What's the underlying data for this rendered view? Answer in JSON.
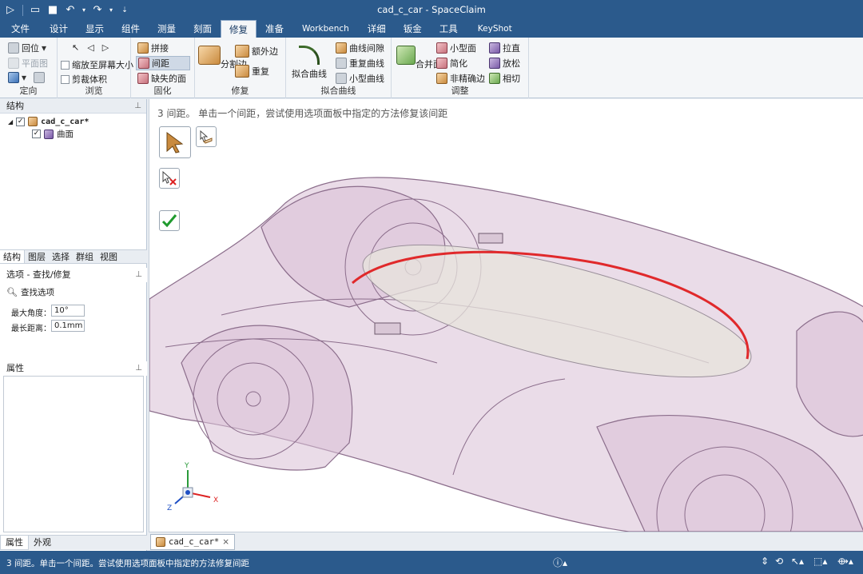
{
  "window": {
    "title": "cad_c_car - SpaceClaim"
  },
  "tabs": [
    {
      "label": "文件"
    },
    {
      "label": "设计"
    },
    {
      "label": "显示"
    },
    {
      "label": "组件"
    },
    {
      "label": "测量"
    },
    {
      "label": "刻面"
    },
    {
      "label": "修复",
      "active": true
    },
    {
      "label": "准备"
    },
    {
      "label": "Workbench"
    },
    {
      "label": "详细"
    },
    {
      "label": "钣金"
    },
    {
      "label": "工具"
    },
    {
      "label": "KeyShot"
    }
  ],
  "ribbon": {
    "orient": {
      "label": "定向",
      "home": "回位",
      "plane_view": "平面图"
    },
    "browse": {
      "label": "浏览",
      "zoom_fit": "缩放至屏幕大小",
      "clip": "剪裁体积"
    },
    "solidify": {
      "label": "固化",
      "stitch": "拼接",
      "gaps": "间距",
      "missing_faces": "缺失的面"
    },
    "fix": {
      "label": "修复",
      "split_edge": "分割边",
      "extra_edges": "额外边",
      "duplicates": "重复"
    },
    "fit_curves": {
      "label": "拟合曲线",
      "fit_curve": "拟合曲线",
      "curve_gaps": "曲线间隙",
      "duplicate_curves": "重复曲线",
      "small_curves": "小型曲线"
    },
    "adjust": {
      "label": "调整",
      "merge_faces": "合并面",
      "small_faces": "小型面",
      "simplify": "简化",
      "inexact_edges": "非精确边",
      "straighten": "拉直",
      "relax": "放松",
      "tangency": "相切"
    }
  },
  "structure_panel": {
    "title": "结构",
    "root": "cad_c_car*",
    "child": "曲面"
  },
  "left_tabs": [
    {
      "label": "结构",
      "active": true
    },
    {
      "label": "图层"
    },
    {
      "label": "选择"
    },
    {
      "label": "群组"
    },
    {
      "label": "视图"
    }
  ],
  "options_panel": {
    "title": "选项 - 查找/修复",
    "find_options": "查找选项",
    "max_angle_label": "最大角度：",
    "max_angle_value": "10°",
    "max_distance_label": "最长距离：",
    "max_distance_value": "0.1mm"
  },
  "properties_panel": {
    "title": "属性"
  },
  "bottom_tabs": [
    {
      "label": "属性",
      "active": true
    },
    {
      "label": "外观"
    }
  ],
  "viewport": {
    "hint": "3 间距。 单击一个间距，尝试使用选项面板中指定的方法修复该间距",
    "triad": {
      "y": "Y",
      "z": "Z",
      "x": "X"
    }
  },
  "doc_tab": {
    "label": "cad_c_car*",
    "close": "×"
  },
  "status": {
    "text": "3 间距。单击一个间距。尝试使用选项面板中指定的方法修复间距"
  },
  "colors": {
    "title_bar": "#2b5a8c",
    "body_tint": "#d9bfd6",
    "highlight_edge": "#e0292b"
  }
}
